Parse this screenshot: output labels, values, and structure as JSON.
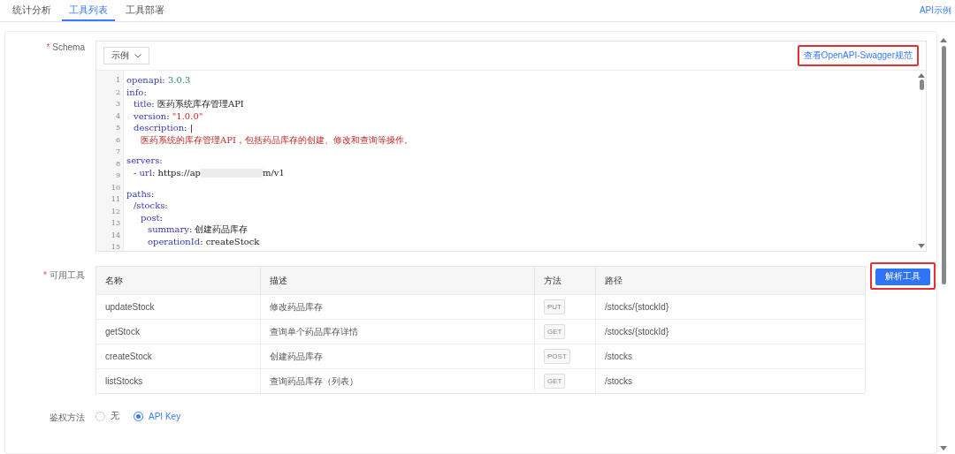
{
  "tabs": [
    {
      "label": "统计分析",
      "selected": false
    },
    {
      "label": "工具列表",
      "selected": true
    },
    {
      "label": "工具部署",
      "selected": false
    }
  ],
  "top_link": "API示例",
  "schema": {
    "label": "Schema",
    "required_mark": "*",
    "example_select": "示例",
    "spec_link": "查看OpenAPI-Swagger规范",
    "lines": [
      {
        "number": "1",
        "kind": "level0",
        "parts": [
          {
            "text": "openapi",
            "kind": "key"
          },
          {
            "text": ": ",
            "kind": "plain"
          },
          {
            "text": "3.0.3",
            "kind": "number"
          }
        ]
      },
      {
        "number": "2",
        "kind": "level0",
        "parts": [
          {
            "text": "info",
            "kind": "key"
          },
          {
            "text": ":",
            "kind": "plain"
          }
        ]
      },
      {
        "number": "3",
        "kind": "level1",
        "parts": [
          {
            "text": "title",
            "kind": "key"
          },
          {
            "text": ": 医药系统库存管理API",
            "kind": "plain"
          }
        ]
      },
      {
        "number": "4",
        "kind": "level1",
        "parts": [
          {
            "text": "version",
            "kind": "key"
          },
          {
            "text": ": ",
            "kind": "plain"
          },
          {
            "text": "\"1.0.0\"",
            "kind": "string"
          }
        ]
      },
      {
        "number": "5",
        "kind": "level1",
        "parts": [
          {
            "text": "description",
            "kind": "key"
          },
          {
            "text": ": |",
            "kind": "plain"
          }
        ]
      },
      {
        "number": "6",
        "kind": "level2",
        "parts": [
          {
            "text": "医药系统的库存管理API，包括药品库存的创建、修改和查询等操作。",
            "kind": "string"
          }
        ]
      },
      {
        "number": "7",
        "kind": "level0"
      },
      {
        "number": "8",
        "kind": "level0",
        "parts": [
          {
            "text": "servers",
            "kind": "key"
          },
          {
            "text": ":",
            "kind": "plain"
          }
        ]
      },
      {
        "number": "9",
        "kind": "level1",
        "parts": [
          {
            "text": "- ",
            "kind": "plain"
          },
          {
            "text": "url",
            "kind": "key"
          },
          {
            "text": ": https://ap",
            "kind": "plain"
          },
          {
            "kind": "redacted"
          },
          {
            "text": "m/v1",
            "kind": "plain"
          }
        ]
      },
      {
        "number": "10",
        "kind": "level0"
      },
      {
        "number": "11",
        "kind": "level0",
        "parts": [
          {
            "text": "paths",
            "kind": "key"
          },
          {
            "text": ":",
            "kind": "plain"
          }
        ]
      },
      {
        "number": "12",
        "kind": "level1",
        "parts": [
          {
            "text": "/stocks",
            "kind": "key"
          },
          {
            "text": ":",
            "kind": "plain"
          }
        ]
      },
      {
        "number": "13",
        "kind": "level2",
        "parts": [
          {
            "text": "post",
            "kind": "key"
          },
          {
            "text": ":",
            "kind": "plain"
          }
        ]
      },
      {
        "number": "14",
        "kind": "level3",
        "parts": [
          {
            "text": "summary",
            "kind": "key"
          },
          {
            "text": ": 创建药品库存",
            "kind": "plain"
          }
        ]
      },
      {
        "number": "15",
        "kind": "level3",
        "parts": [
          {
            "text": "operationId",
            "kind": "key"
          },
          {
            "text": ": createStock",
            "kind": "plain"
          }
        ]
      }
    ]
  },
  "tools": {
    "label": "可用工具",
    "required_mark": "*",
    "parse_button": "解析工具",
    "columns": [
      "名称",
      "描述",
      "方法",
      "路径"
    ],
    "rows": [
      {
        "name": "updateStock",
        "description": "修改药品库存",
        "method": "PUT",
        "path": "/stocks/{stockId}"
      },
      {
        "name": "getStock",
        "description": "查询单个药品库存详情",
        "method": "GET",
        "path": "/stocks/{stockId}"
      },
      {
        "name": "createStock",
        "description": "创建药品库存",
        "method": "POST",
        "path": "/stocks"
      },
      {
        "name": "listStocks",
        "description": "查询药品库存（列表）",
        "method": "GET",
        "path": "/stocks"
      }
    ]
  },
  "auth": {
    "label": "鉴权方法",
    "options": [
      {
        "label": "无",
        "selected": false
      },
      {
        "label": "API Key",
        "selected": true
      }
    ]
  }
}
